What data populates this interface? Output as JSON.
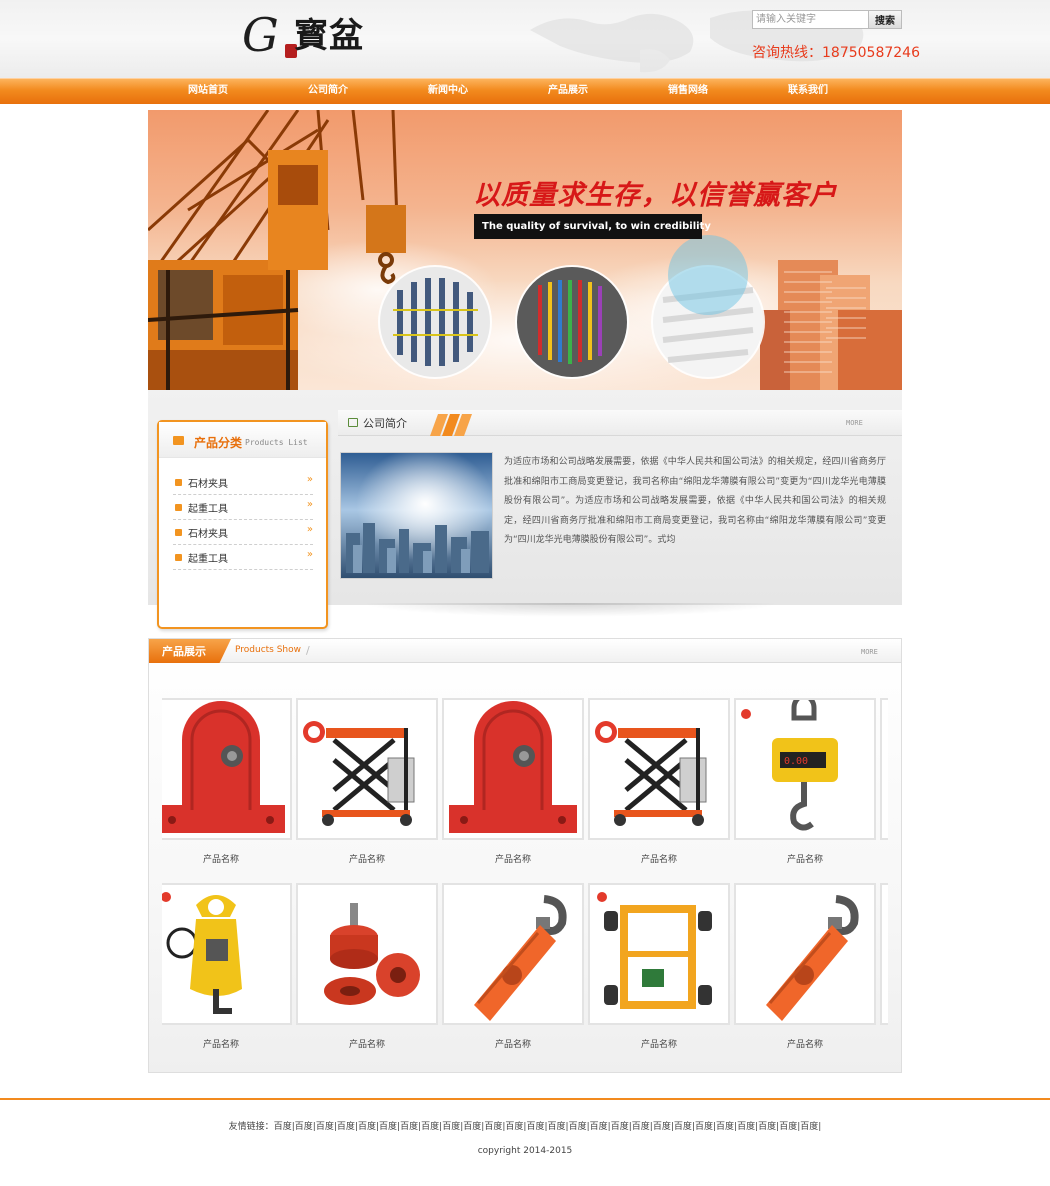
{
  "header": {
    "search_placeholder": "请输入关键字",
    "search_button": "搜索",
    "hotline": "咨询热线：18750587246",
    "logo_text": "G寳盆"
  },
  "nav": {
    "items": [
      {
        "label": "网站首页"
      },
      {
        "label": "公司简介"
      },
      {
        "label": "新闻中心"
      },
      {
        "label": "产品展示"
      },
      {
        "label": "销售网络"
      },
      {
        "label": "联系我们"
      }
    ]
  },
  "banner": {
    "title": "以质量求生存，以信誉赢客户",
    "subtitle": "The quality of survival, to win credibility"
  },
  "categories": {
    "title": "产品分类",
    "title_en": "Products List",
    "items": [
      {
        "label": "石材夹具",
        "arrow": "»"
      },
      {
        "label": "起重工具",
        "arrow": "»"
      },
      {
        "label": "石材夹具",
        "arrow": "»"
      },
      {
        "label": "起重工具",
        "arrow": "»"
      }
    ]
  },
  "about": {
    "title": "公司简介",
    "more": "MORE",
    "text": "为适应市场和公司战略发展需要，依据《中华人民共和国公司法》的相关规定，经四川省商务厅批准和绵阳市工商局变更登记，我司名称由“绵阳龙华薄膜有限公司”变更为“四川龙华光电薄膜股份有限公司”。为适应市场和公司战略发展需要，依据《中华人民共和国公司法》的相关规定，经四川省商务厅批准和绵阳市工商局变更登记，我司名称由“绵阳龙华薄膜有限公司”变更为“四川龙华光电薄膜股份有限公司”。式均"
  },
  "products": {
    "title": "产品展示",
    "title_en": "Products Show",
    "more": "MORE",
    "items": [
      {
        "name": "产品名称",
        "icon": "pulley-block-icon"
      },
      {
        "name": "产品名称",
        "icon": "lift-table-icon"
      },
      {
        "name": "产品名称",
        "icon": "pulley-block-icon"
      },
      {
        "name": "产品名称",
        "icon": "lift-table-icon"
      },
      {
        "name": "产品名称",
        "icon": "crane-scale-icon"
      },
      {
        "name": "产品名称",
        "icon": "plate-clamp-icon"
      },
      {
        "name": "产品名称",
        "icon": "gear-parts-icon"
      },
      {
        "name": "产品名称",
        "icon": "snatch-block-icon"
      },
      {
        "name": "产品名称",
        "icon": "trolley-frame-icon"
      },
      {
        "name": "产品名称",
        "icon": "snatch-block-icon"
      }
    ]
  },
  "footer": {
    "links_label": "友情链接：",
    "links": [
      "百度",
      "百度",
      "百度",
      "百度",
      "百度",
      "百度",
      "百度",
      "百度",
      "百度",
      "百度",
      "百度",
      "百度",
      "百度",
      "百度",
      "百度",
      "百度",
      "百度",
      "百度",
      "百度",
      "百度",
      "百度",
      "百度",
      "百度",
      "百度",
      "百度",
      "百度"
    ],
    "copyright": "copyright 2014-2015"
  },
  "colors": {
    "accent_orange": "#f28a1e",
    "hotline_red": "#e83b1c",
    "banner_title_red": "#d71818"
  }
}
